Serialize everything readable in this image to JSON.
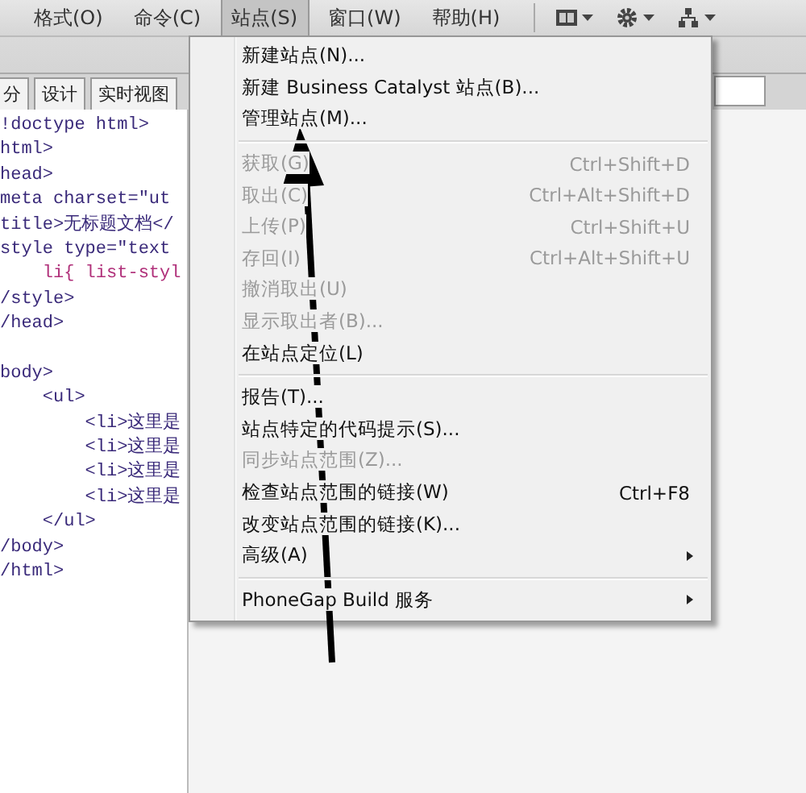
{
  "menubar": {
    "items": [
      {
        "label": "格式(O)",
        "selected": false
      },
      {
        "label": "命令(C)",
        "selected": false
      },
      {
        "label": "站点(S)",
        "selected": true
      },
      {
        "label": "窗口(W)",
        "selected": false
      },
      {
        "label": "帮助(H)",
        "selected": false
      }
    ],
    "tools": [
      {
        "kind": "layout"
      },
      {
        "kind": "gear"
      },
      {
        "kind": "sitemap"
      }
    ]
  },
  "view_tabs": [
    {
      "label": "分",
      "selected": false
    },
    {
      "label": "设计",
      "selected": false
    },
    {
      "label": "实时视图",
      "selected": false
    }
  ],
  "code_lines": [
    {
      "kind": "tag",
      "text": "!doctype html>"
    },
    {
      "kind": "tag",
      "text": "html>"
    },
    {
      "kind": "tag",
      "text": "head>"
    },
    {
      "kind": "tag",
      "text": "meta charset=\"ut"
    },
    {
      "kind": "tag",
      "text": "title>无标题文档</"
    },
    {
      "kind": "tag",
      "text": "style type=\"text"
    },
    {
      "kind": "css",
      "text": "    li{ list-styl"
    },
    {
      "kind": "tag",
      "text": "/style>"
    },
    {
      "kind": "tag",
      "text": "/head>"
    },
    {
      "kind": "blank"
    },
    {
      "kind": "tag",
      "text": "body>"
    },
    {
      "kind": "tag",
      "text": "    <ul>"
    },
    {
      "kind": "tag",
      "text": "        <li>这里是"
    },
    {
      "kind": "tag",
      "text": "        <li>这里是"
    },
    {
      "kind": "tag",
      "text": "        <li>这里是"
    },
    {
      "kind": "tag",
      "text": "        <li>这里是"
    },
    {
      "kind": "tag",
      "text": "    </ul>"
    },
    {
      "kind": "tag",
      "text": "/body>"
    },
    {
      "kind": "tag",
      "text": "/html>"
    }
  ],
  "site_menu": [
    {
      "kind": "item",
      "label": "新建站点(N)...",
      "disabled": false
    },
    {
      "kind": "item",
      "label": "新建 Business Catalyst 站点(B)...",
      "disabled": false
    },
    {
      "kind": "item",
      "label": "管理站点(M)...",
      "disabled": false
    },
    {
      "kind": "separator"
    },
    {
      "kind": "item",
      "label": "获取(G)",
      "shortcut": "Ctrl+Shift+D",
      "disabled": true
    },
    {
      "kind": "item",
      "label": "取出(C)",
      "shortcut": "Ctrl+Alt+Shift+D",
      "disabled": true
    },
    {
      "kind": "item",
      "label": "上传(P)",
      "shortcut": "Ctrl+Shift+U",
      "disabled": true
    },
    {
      "kind": "item",
      "label": "存回(I)",
      "shortcut": "Ctrl+Alt+Shift+U",
      "disabled": true
    },
    {
      "kind": "item",
      "label": "撤消取出(U)",
      "disabled": true
    },
    {
      "kind": "item",
      "label": "显示取出者(B)...",
      "disabled": true
    },
    {
      "kind": "item",
      "label": "在站点定位(L)",
      "disabled": false
    },
    {
      "kind": "separator"
    },
    {
      "kind": "item",
      "label": "报告(T)...",
      "disabled": false
    },
    {
      "kind": "item",
      "label": "站点特定的代码提示(S)...",
      "disabled": false
    },
    {
      "kind": "item",
      "label": "同步站点范围(Z)...",
      "disabled": true
    },
    {
      "kind": "item",
      "label": "检查站点范围的链接(W)",
      "shortcut": "Ctrl+F8",
      "disabled": false
    },
    {
      "kind": "item",
      "label": "改变站点范围的链接(K)...",
      "disabled": false
    },
    {
      "kind": "item",
      "label": "高级(A)",
      "submenu": true,
      "disabled": false
    },
    {
      "kind": "separator"
    },
    {
      "kind": "item",
      "label": "PhoneGap Build 服务",
      "submenu": true,
      "disabled": false
    }
  ]
}
